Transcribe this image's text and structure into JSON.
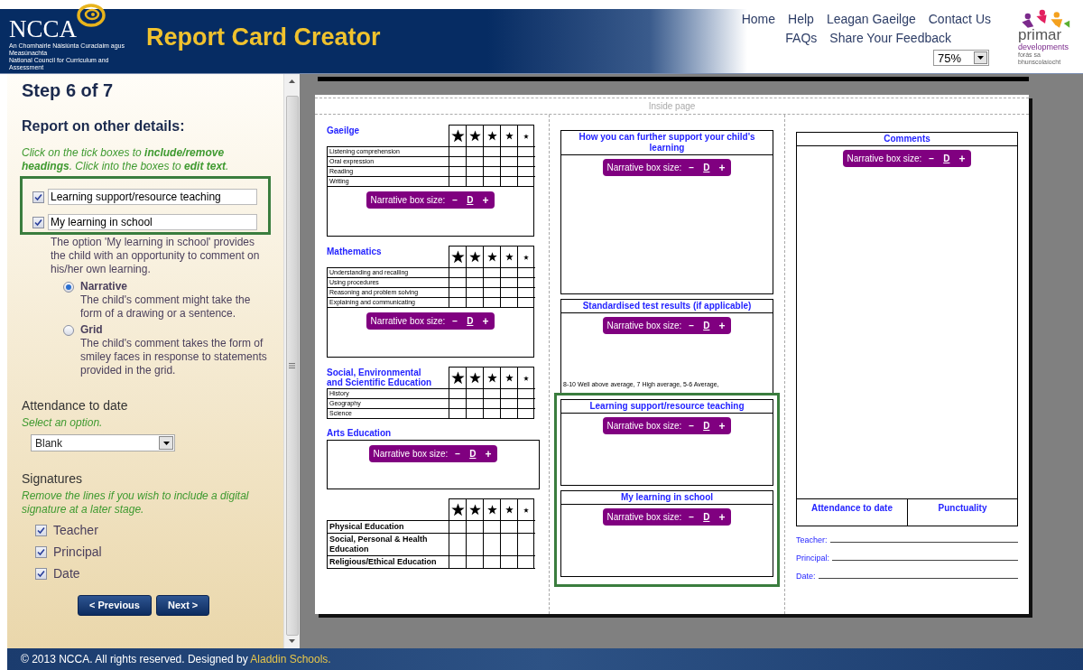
{
  "header": {
    "logo": {
      "name": "NCCA",
      "subtitle_irish": "An Chomhairle Náisiúnta Curaclaim agus Measúnachta",
      "subtitle_english": "National Council for Curriculum and Assessment"
    },
    "title": "Report Card Creator",
    "nav": [
      [
        "Home",
        "Help",
        "Leagan Gaeilge",
        "Contact Us"
      ],
      [
        "FAQs",
        "Share Your Feedback"
      ]
    ],
    "zoom": {
      "value": "75%"
    },
    "partner_logo": {
      "name": "primar",
      "subtitle": "developments",
      "tagline": "forás sa bhunscolaíocht"
    }
  },
  "sidebar": {
    "step": "Step 6 of 7",
    "heading": "Report on other details:",
    "instructions": "Click on the tick boxes to **include/remove headings**. Click into the boxes to **edit text**.",
    "headings": [
      {
        "checked": true,
        "value": "Learning support/resource teaching"
      },
      {
        "checked": true,
        "value": "My learning in school"
      }
    ],
    "note": "The option 'My learning in school' provides the child with an opportunity to comment on his/her own learning.",
    "options": [
      {
        "label": "Narrative",
        "description": "The child's comment might take the form of a drawing or a sentence.",
        "selected": true
      },
      {
        "label": "Grid",
        "description": "The child's comment takes the form of smiley faces in response to statements provided in the grid.",
        "selected": false
      }
    ],
    "attendance": {
      "title": "Attendance to date",
      "hint": "Select an option.",
      "value": "Blank"
    },
    "signatures": {
      "title": "Signatures",
      "hint": "Remove the lines if you wish to include a digital signature at a later stage.",
      "items": [
        {
          "label": "Teacher",
          "checked": true
        },
        {
          "label": "Principal",
          "checked": true
        },
        {
          "label": "Date",
          "checked": true
        }
      ]
    },
    "buttons": [
      "< Previous",
      "Next >"
    ]
  },
  "preview": {
    "page_label": "Inside page",
    "column_1": [
      {
        "kind": "strands",
        "title": "Gaeilge",
        "rows": [
          "Listening comprehension",
          "Oral expression",
          "Reading",
          "Writing"
        ],
        "control": {
          "label": "Narrative box size:",
          "decrease": "−",
          "reset": "D",
          "increase": "+"
        }
      },
      {
        "kind": "strands",
        "title": "Mathematics",
        "rows": [
          "Understanding and recalling",
          "Using procedures",
          "Reasoning and problem solving",
          "Explaining and communicating"
        ],
        "control": {
          "label": "Narrative box size:",
          "decrease": "−",
          "reset": "D",
          "increase": "+"
        }
      },
      {
        "kind": "strands",
        "title": "Social, Environmental and Scientific Education",
        "rows": [
          "History",
          "Geography",
          "Science"
        ]
      },
      {
        "kind": "narrative",
        "title": "Arts Education",
        "control": {
          "label": "Narrative box size:",
          "decrease": "−",
          "reset": "D",
          "increase": "+"
        }
      },
      {
        "kind": "subjects",
        "rows": [
          "Physical Education",
          "Social, Personal & Health Education",
          "Religious/Ethical Education"
        ]
      }
    ],
    "column_2": [
      {
        "title": "How you can further support your child's learning",
        "highlighted": false,
        "control": {
          "label": "Narrative box size:",
          "decrease": "−",
          "reset": "D",
          "increase": "+"
        }
      },
      {
        "title": "Standardised test results (if applicable)",
        "highlighted": false,
        "note": "8-10 Well above average, 7 High average, 5-6 Average,",
        "control": {
          "label": "Narrative box size:",
          "decrease": "−",
          "reset": "D",
          "increase": "+"
        }
      },
      {
        "title": "Learning support/resource teaching",
        "highlighted": true,
        "control": {
          "label": "Narrative box size:",
          "decrease": "−",
          "reset": "D",
          "increase": "+"
        }
      },
      {
        "title": "My learning in school",
        "highlighted": true,
        "control": {
          "label": "Narrative box size:",
          "decrease": "−",
          "reset": "D",
          "increase": "+"
        }
      }
    ],
    "column_3": {
      "comments": {
        "title": "Comments",
        "control": {
          "label": "Narrative box size:",
          "decrease": "−",
          "reset": "D",
          "increase": "+"
        }
      },
      "cells": [
        "Attendance to date",
        "Punctuality"
      ],
      "signatures": [
        "Teacher:",
        "Principal:",
        "Date:"
      ]
    }
  },
  "footer": {
    "text": "© 2013 NCCA. All rights reserved. Designed by",
    "link": "Aladdin Schools."
  }
}
